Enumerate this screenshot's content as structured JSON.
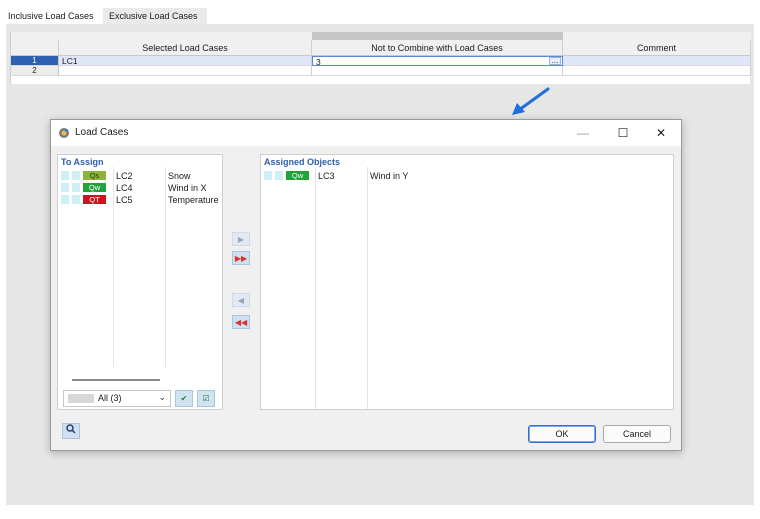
{
  "tabs": {
    "inclusive": "Inclusive Load Cases",
    "exclusive": "Exclusive Load Cases"
  },
  "grid": {
    "columns": [
      "Selected Load Cases",
      "Not to Combine with Load Cases",
      "Comment"
    ],
    "rows": [
      {
        "num": "1",
        "selected": "LC1",
        "not_combine": "3",
        "comment": ""
      },
      {
        "num": "2",
        "selected": "",
        "not_combine": "",
        "comment": ""
      }
    ],
    "dots": "..."
  },
  "dialog": {
    "title": "Load Cases",
    "minimize": "—",
    "maximize": "☐",
    "close": "✕",
    "to_assign": {
      "title": "To Assign",
      "items": [
        {
          "badge": "Qs",
          "lc": "LC2",
          "desc": "Snow",
          "color": "#8db43a"
        },
        {
          "badge": "Qw",
          "lc": "LC4",
          "desc": "Wind in X",
          "color": "#22a33a"
        },
        {
          "badge": "QT",
          "lc": "LC5",
          "desc": "Temperature",
          "color": "#c8171e"
        }
      ]
    },
    "assigned": {
      "title": "Assigned Objects",
      "items": [
        {
          "badge": "Qw",
          "lc": "LC3",
          "desc": "Wind in Y",
          "color": "#22a33a"
        }
      ]
    },
    "filter": {
      "value": "All (3)"
    },
    "buttons": {
      "ok": "OK",
      "cancel": "Cancel"
    },
    "icons": {
      "assign_one": "▶",
      "assign_all": "▶▶",
      "remove_one": "◀",
      "remove_all": "◀◀",
      "help": "🔍",
      "select_all": "✔",
      "select_visible": "☑"
    },
    "accent": "#2f5fb0"
  }
}
